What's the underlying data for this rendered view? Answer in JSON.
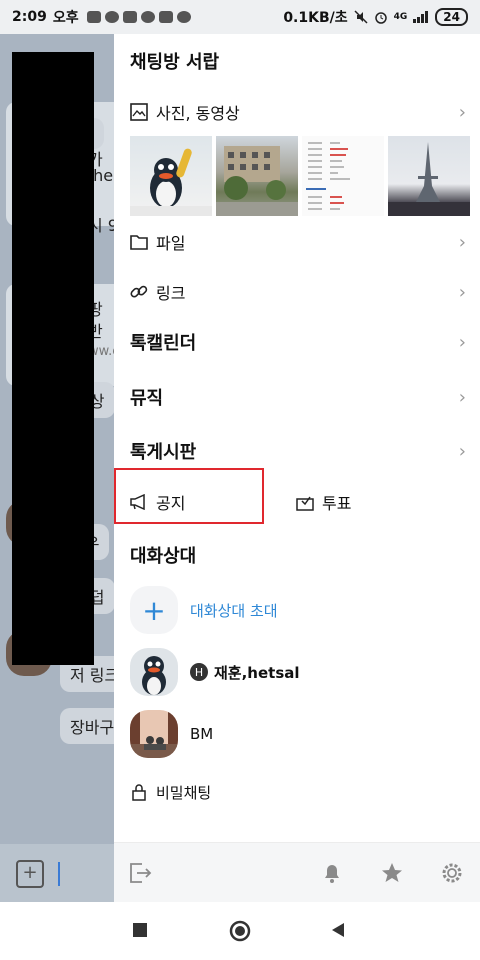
{
  "status_bar": {
    "time": "2:09",
    "ampm": "오후",
    "speed": "0.1KB/초",
    "network": "4G",
    "battery": "24"
  },
  "background_chat": {
    "snippets": [
      "ps:",
      "카",
      ",he",
      "시 9",
      "팡",
      "반",
      "ww.c",
      "거 상",
      "ㅇ우",
      "재 덥",
      "저 링크",
      "장바구"
    ]
  },
  "drawer": {
    "title": "채팅방 서랍",
    "photos_label": "사진, 동영상",
    "files_label": "파일",
    "links_label": "링크",
    "calendar_label": "톡캘린더",
    "music_label": "뮤직",
    "board_label": "톡게시판",
    "notice_label": "공지",
    "vote_label": "투표",
    "members_title": "대화상대",
    "invite_label": "대화상대 초대",
    "members": [
      {
        "badge": "H",
        "name": "재훈,hetsal"
      },
      {
        "name": "BM"
      }
    ],
    "secret_chat_label": "비밀채팅"
  },
  "colors": {
    "accent": "#2f88d6",
    "highlight_border": "#e0282e",
    "dim_overlay": "#8f9baa"
  }
}
